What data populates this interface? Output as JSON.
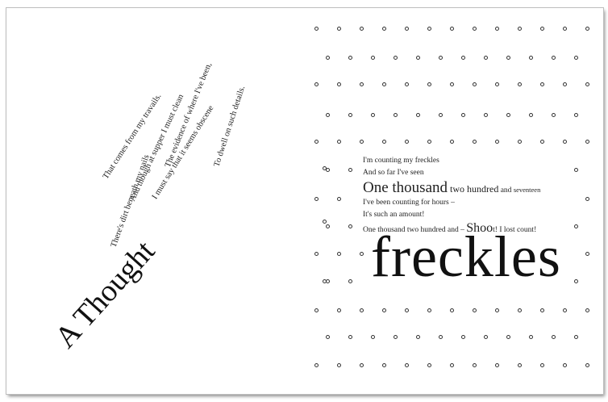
{
  "left_page": {
    "title": "A Thought",
    "poem_lines": [
      "There's dirt beneath my nails",
      "That comes from my travails.",
      "And though at supper I must clean",
      "The evidence of where I've been,",
      "I must say that it seems obscene",
      "To dwell on such details."
    ]
  },
  "right_page": {
    "verse": {
      "line1": "I'm counting my freckles",
      "line2": "And so far I've seen",
      "line3_big": "One thousand",
      "line3_mid": " two hundred",
      "line3_rest": " and ",
      "line3_small": "seventeen",
      "line4": "I've been counting for hours –",
      "line5": "It's such an amount!",
      "line6_start": "One thousand two hundred and – ",
      "line6_shoo": "Shoo",
      "line6_t": "t!",
      "line6_end": " I lost count!"
    },
    "title": "freckles"
  }
}
